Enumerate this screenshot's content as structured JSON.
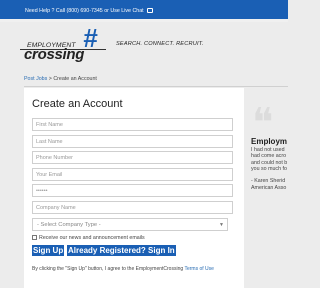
{
  "topbar": {
    "text": "Need Help ? Call (800) 690-7345 or Use Live Chat",
    "chat_icon": "chat-bubble-icon",
    "background": "#1a5fb4"
  },
  "header": {
    "logo_word1": "EMPLOYMENT",
    "logo_word2": "crossing",
    "logo_hash": "#",
    "tagline": "SEARCH. CONNECT. RECRUIT."
  },
  "breadcrumb": {
    "link": "Post Jobs",
    "separator": ">",
    "current": "Create an Account"
  },
  "form": {
    "title": "Create an Account",
    "fields": [
      {
        "placeholder": "First Name"
      },
      {
        "placeholder": "Last Name"
      },
      {
        "placeholder": "Phone Number"
      },
      {
        "placeholder": "Your Email"
      },
      {
        "placeholder": "••••••"
      },
      {
        "placeholder": "Company Name"
      }
    ],
    "company_type": "- Select Company Type -",
    "newsletter_label": "Receive our news and announcement emails",
    "signup_button": "Sign Up",
    "signin_button": "Already Registered? Sign In",
    "terms_text": "By clicking the \"Sign Up\" button, I agree to the EmploymentCrossing",
    "terms_link": "Terms of Use"
  },
  "testimonial": {
    "quote_mark": "❝",
    "name": "Employm",
    "lines": [
      "I had not used",
      "had come acro",
      "and could not b",
      "you so much fo"
    ],
    "attribution": [
      "- Karen Sherid",
      "American Asso"
    ]
  },
  "accent_color": "#1a5fb4"
}
